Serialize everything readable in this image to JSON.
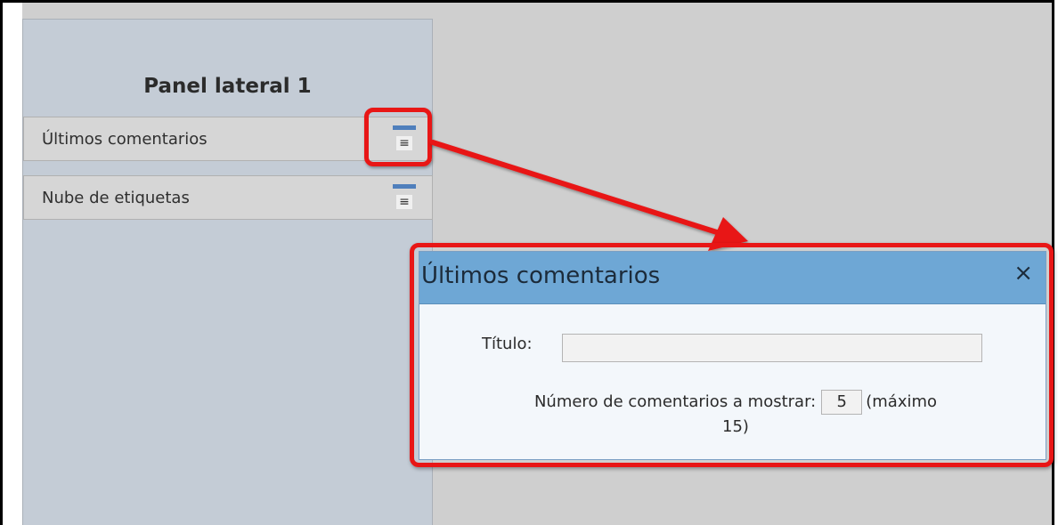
{
  "sidebar": {
    "title": "Panel lateral 1",
    "widgets": [
      {
        "label": "Últimos comentarios",
        "menu_icon": "≡"
      },
      {
        "label": "Nube de etiquetas",
        "menu_icon": "≡"
      }
    ]
  },
  "dialog": {
    "title": "Últimos comentarios",
    "close": "×",
    "title_field_label": "Título:",
    "title_field_value": "",
    "count_label": "Número de comentarios a mostrar:",
    "count_value": "5",
    "count_suffix_line1": "(máximo",
    "count_suffix_line2": "15)"
  },
  "colors": {
    "highlight": "#e81616",
    "dialog_header": "#6ea7d5",
    "sidebar_bg": "#c4ccd6",
    "menu_bar": "#4f7fbc"
  }
}
